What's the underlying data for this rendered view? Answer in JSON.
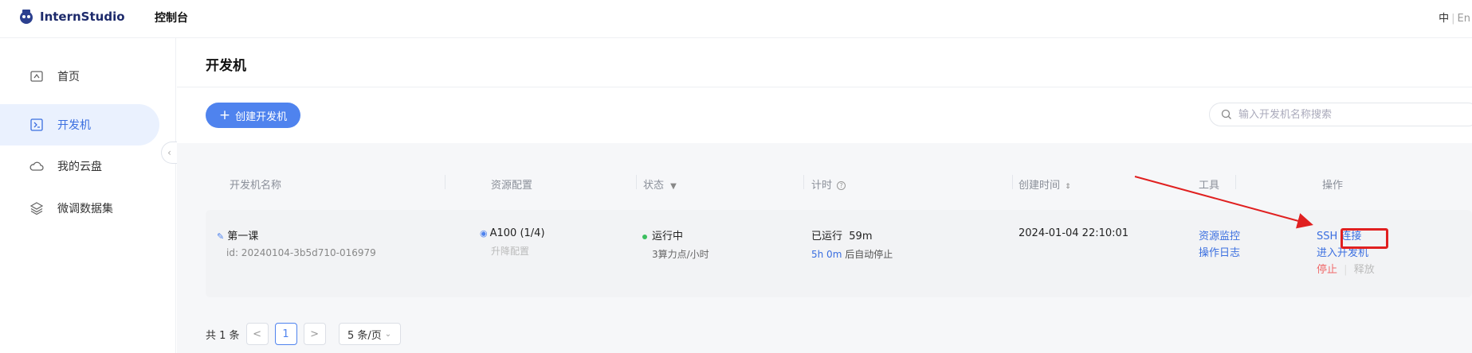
{
  "header": {
    "brand": "InternStudio",
    "console": "控制台",
    "lang_zh": "中",
    "lang_sep": "|",
    "lang_en": "En"
  },
  "sidebar": {
    "items": [
      {
        "label": "首页",
        "icon": "home-icon",
        "active": false
      },
      {
        "label": "开发机",
        "icon": "terminal-icon",
        "active": true
      },
      {
        "label": "我的云盘",
        "icon": "cloud-icon",
        "active": false
      },
      {
        "label": "微调数据集",
        "icon": "layers-icon",
        "active": false
      }
    ]
  },
  "main": {
    "title": "开发机",
    "create_button": "创建开发机",
    "search_placeholder": "输入开发机名称搜索"
  },
  "table": {
    "headers": [
      "开发机名称",
      "资源配置",
      "状态",
      "计时",
      "创建时间",
      "工具",
      "操作"
    ],
    "row": {
      "name": "第一课",
      "id": "id: 20240104-3b5d710-016979",
      "resource": "A100 (1/4)",
      "resource_sub": "升降配置",
      "status": "运行中",
      "status_sub": "3算力点/小时",
      "timer_label": "已运行",
      "timer_value": "59m",
      "timer_sub_value": "5h 0m",
      "timer_sub_text": "后自动停止",
      "created": "2024-01-04 22:10:01",
      "tools": [
        "资源监控",
        "操作日志"
      ],
      "ops_ssh": "SSH 连接",
      "ops_enter": "进入开发机",
      "ops_stop": "停止",
      "ops_sep": "|",
      "ops_release": "释放"
    }
  },
  "pagination": {
    "total": "共 1 条",
    "prev": "<",
    "page": "1",
    "next": ">",
    "size": "5 条/页"
  },
  "colors": {
    "accent": "#4f83ee",
    "highlight": "#e02020",
    "running": "#3cbf5f"
  }
}
